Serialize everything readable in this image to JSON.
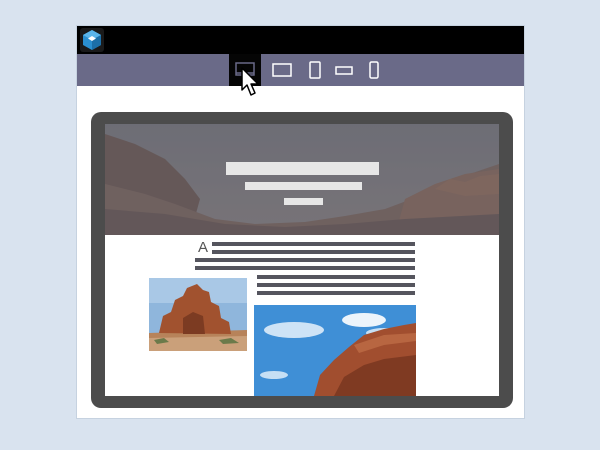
{
  "app": {
    "logo_icon": "cube-logo-icon"
  },
  "devices": [
    {
      "name": "desktop",
      "icon": "desktop-icon",
      "active": true
    },
    {
      "name": "tablet-landscape",
      "icon": "tablet-landscape-icon",
      "active": false
    },
    {
      "name": "tablet-portrait",
      "icon": "tablet-portrait-icon",
      "active": false
    },
    {
      "name": "phone-landscape",
      "icon": "phone-landscape-icon",
      "active": false
    },
    {
      "name": "phone-portrait",
      "icon": "phone-portrait-icon",
      "active": false
    }
  ],
  "preview": {
    "dropcap": "A"
  },
  "colors": {
    "page_bg": "#d9e3ef",
    "titlebar": "#000000",
    "devicebar": "#6a6a88",
    "active_device": "#050505",
    "frame": "#4c4c4c",
    "text_lines": "#55555e",
    "logo_blue": "#2a8fd0"
  }
}
